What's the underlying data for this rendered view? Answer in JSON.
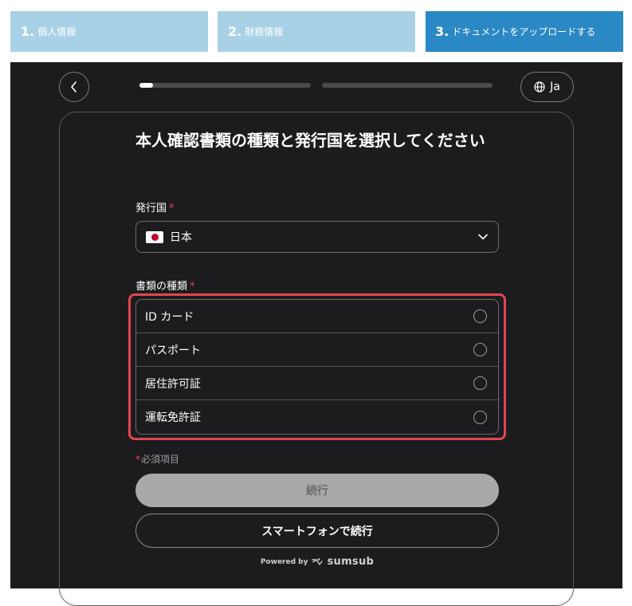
{
  "steps": [
    {
      "num": "1.",
      "label": "個人情報",
      "active": false
    },
    {
      "num": "2.",
      "label": "財務情報",
      "active": false
    },
    {
      "num": "3.",
      "label": "ドキュメントをアップロードする",
      "active": true
    }
  ],
  "header": {
    "back_icon": "chevron-left-icon",
    "progress": [
      0.08,
      0.0
    ],
    "language": "Ja",
    "language_icon": "globe-icon"
  },
  "form": {
    "title": "本人確認書類の種類と発行国を選択してください",
    "country_label": "発行国",
    "country_value": "日本",
    "country_flag": "japan-flag-icon",
    "doc_type_label": "書類の種類",
    "required_mark": "*",
    "doc_types": [
      "ID カード",
      "パスポート",
      "居住許可証",
      "運転免許証"
    ],
    "required_note": "必須項目",
    "continue_label": "続行",
    "phone_label": "スマートフォンで続行"
  },
  "footer": {
    "powered_by": "Powered by",
    "brand": "sumsub"
  },
  "colors": {
    "step_inactive": "#a8d1e6",
    "step_active": "#2a88c5",
    "panel_bg": "#1c1c1f",
    "highlight": "#e0474c",
    "required": "#e5484d"
  }
}
